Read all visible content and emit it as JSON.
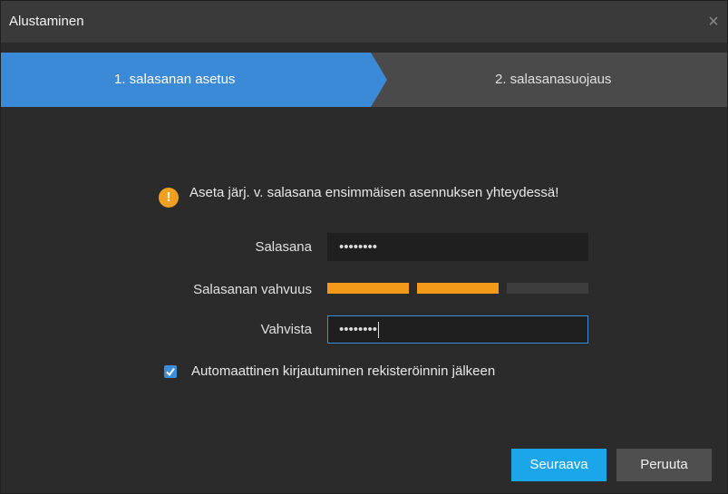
{
  "window": {
    "title": "Alustaminen",
    "close_glyph": "×"
  },
  "steps": [
    {
      "label": "1. salasanan asetus",
      "active": true
    },
    {
      "label": "2. salasanasuojaus",
      "active": false
    }
  ],
  "notice": {
    "icon": "warning-icon",
    "icon_glyph": "!",
    "text": "Aseta järj. v. salasana ensimmäisen asennuksen yhteydessä!"
  },
  "form": {
    "password_label": "Salasana",
    "password_value": "••••••••",
    "strength_label": "Salasanan vahvuus",
    "strength_level": 2,
    "strength_max": 3,
    "confirm_label": "Vahvista",
    "confirm_value": "••••••••",
    "auto_login_label": "Automaattinen kirjautuminen rekisteröinnin jälkeen",
    "auto_login_checked": true
  },
  "buttons": {
    "next_label": "Seuraava",
    "cancel_label": "Peruuta"
  },
  "colors": {
    "accent": "#3d8ed6",
    "step_active": "#3a8ad8",
    "strength_on": "#f49a1a",
    "primary_button": "#1aa6e8",
    "warning": "#f0a020"
  }
}
